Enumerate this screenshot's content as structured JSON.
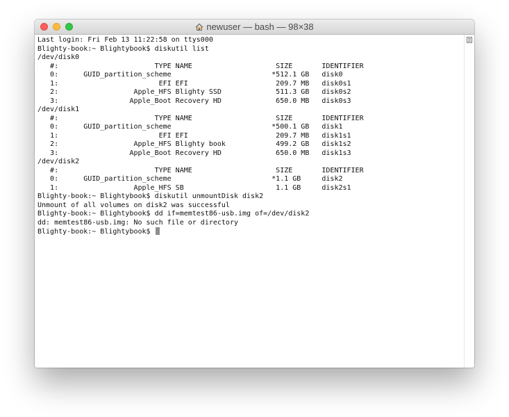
{
  "window": {
    "title": "newuser — bash — 98×38"
  },
  "terminal": {
    "lines": [
      "Last login: Fri Feb 13 11:22:58 on ttys000",
      "Blighty-book:~ Blightybook$ diskutil list",
      "/dev/disk0",
      "   #:                       TYPE NAME                    SIZE       IDENTIFIER",
      "   0:      GUID_partition_scheme                        *512.1 GB   disk0",
      "   1:                        EFI EFI                     209.7 MB   disk0s1",
      "   2:                  Apple_HFS Blighty SSD             511.3 GB   disk0s2",
      "   3:                 Apple_Boot Recovery HD             650.0 MB   disk0s3",
      "/dev/disk1",
      "   #:                       TYPE NAME                    SIZE       IDENTIFIER",
      "   0:      GUID_partition_scheme                        *500.1 GB   disk1",
      "   1:                        EFI EFI                     209.7 MB   disk1s1",
      "   2:                  Apple_HFS Blighty book            499.2 GB   disk1s2",
      "   3:                 Apple_Boot Recovery HD             650.0 MB   disk1s3",
      "/dev/disk2",
      "   #:                       TYPE NAME                    SIZE       IDENTIFIER",
      "   0:      GUID_partition_scheme                        *1.1 GB     disk2",
      "   1:                  Apple_HFS SB                      1.1 GB     disk2s1",
      "Blighty-book:~ Blightybook$ diskutil unmountDisk disk2",
      "Unmount of all volumes on disk2 was successful",
      "Blighty-book:~ Blightybook$ dd if=memtest86-usb.img of=/dev/disk2",
      "dd: memtest86-usb.img: No such file or directory"
    ],
    "prompt": "Blighty-book:~ Blightybook$ "
  },
  "icons": {
    "title_icon": "house-icon",
    "scroll_icon": "scroll-grip-icon"
  },
  "colors": {
    "close": "#fc605b",
    "minimize": "#fdbc40",
    "maximize": "#34c84a",
    "text": "#111111",
    "cursor": "#8e8e8e"
  }
}
